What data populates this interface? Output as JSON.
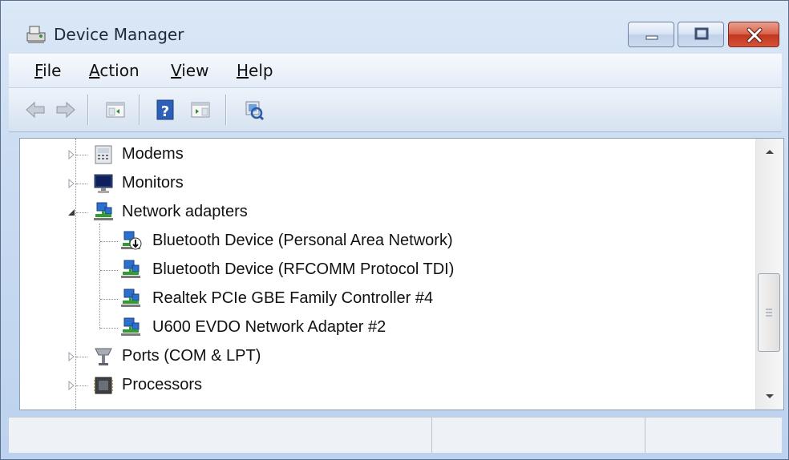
{
  "window": {
    "title": "Device Manager",
    "icon": "device-manager-icon",
    "controls": [
      "minimize",
      "maximize",
      "close"
    ]
  },
  "menu": [
    {
      "label": "File",
      "mnemonic": "F",
      "rest": "ile"
    },
    {
      "label": "Action",
      "mnemonic": "A",
      "rest": "ction"
    },
    {
      "label": "View",
      "mnemonic": "V",
      "rest": "iew"
    },
    {
      "label": "Help",
      "mnemonic": "H",
      "rest": "elp"
    }
  ],
  "toolbar": {
    "buttons": [
      "back-arrow-icon",
      "forward-arrow-icon",
      "show-hide-console-tree-icon",
      "help-icon",
      "show-hide-action-pane-icon",
      "scan-hardware-changes-icon"
    ]
  },
  "tree": {
    "categories": [
      {
        "label": "Modems",
        "icon": "modem-icon",
        "expanded": false
      },
      {
        "label": "Monitors",
        "icon": "monitor-icon",
        "expanded": false
      },
      {
        "label": "Network adapters",
        "icon": "network-adapter-icon",
        "expanded": true,
        "children": [
          {
            "label": "Bluetooth Device (Personal Area Network)",
            "icon": "network-adapter-disabled-icon"
          },
          {
            "label": "Bluetooth Device (RFCOMM Protocol TDI)",
            "icon": "network-adapter-icon"
          },
          {
            "label": "Realtek PCIe GBE Family Controller #4",
            "icon": "network-adapter-icon"
          },
          {
            "label": "U600 EVDO Network Adapter #2",
            "icon": "network-adapter-icon"
          }
        ]
      },
      {
        "label": "Ports (COM & LPT)",
        "icon": "port-icon",
        "expanded": false
      },
      {
        "label": "Processors",
        "icon": "processor-icon",
        "expanded": false
      }
    ]
  },
  "statusbar": {
    "cells": [
      "",
      "",
      ""
    ]
  },
  "colors": {
    "close_button": "#c2361f",
    "frame": "#bcd2ee",
    "network_green": "#2f9d2f",
    "network_blue": "#2b6fcf"
  }
}
